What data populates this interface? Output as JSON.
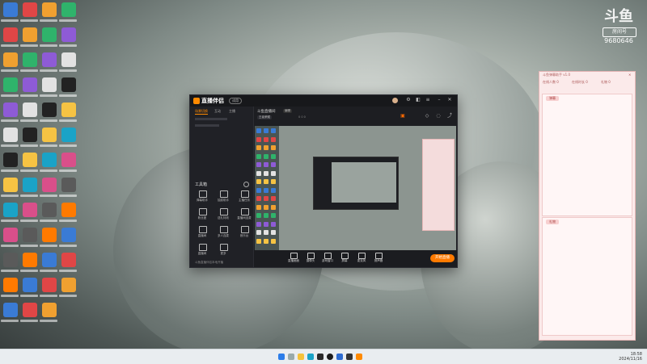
{
  "watermark": {
    "logo": "斗鱼",
    "room_label": "房间号",
    "room_number": "9680646"
  },
  "app": {
    "name": "直播伴侣",
    "version_badge": "试用",
    "tabs": [
      "场景切换",
      "互动",
      "主播"
    ],
    "toolbox_label": "工具箱",
    "tools": [
      "弹幕助手",
      "抽奖助手",
      "主播任务",
      "粉丝团",
      "送礼特效",
      "直播间连麦",
      "直播间",
      "多人连麦",
      "音乐台",
      "直播间",
      "更多"
    ],
    "footer": "斗鱼直播伴侣本地开播",
    "room_title": "斗鱼直播间",
    "room_tag": "编辑",
    "room_category": "王者荣耀",
    "room_stats": "0  0  0",
    "bottom": [
      "直播画面",
      "摄像头",
      "游戏窗口",
      "屏幕",
      "麦克风",
      "扬声器"
    ],
    "go_live": "开始直播"
  },
  "chat": {
    "title": "斗鱼弹幕助手 v1.0",
    "stats": [
      "在线人数 0",
      "在线时长 0",
      "礼物 0"
    ],
    "box1_header": "弹幕",
    "box2_header": "礼物"
  },
  "tray": {
    "time": "18:58",
    "date": "2024/11/16"
  }
}
